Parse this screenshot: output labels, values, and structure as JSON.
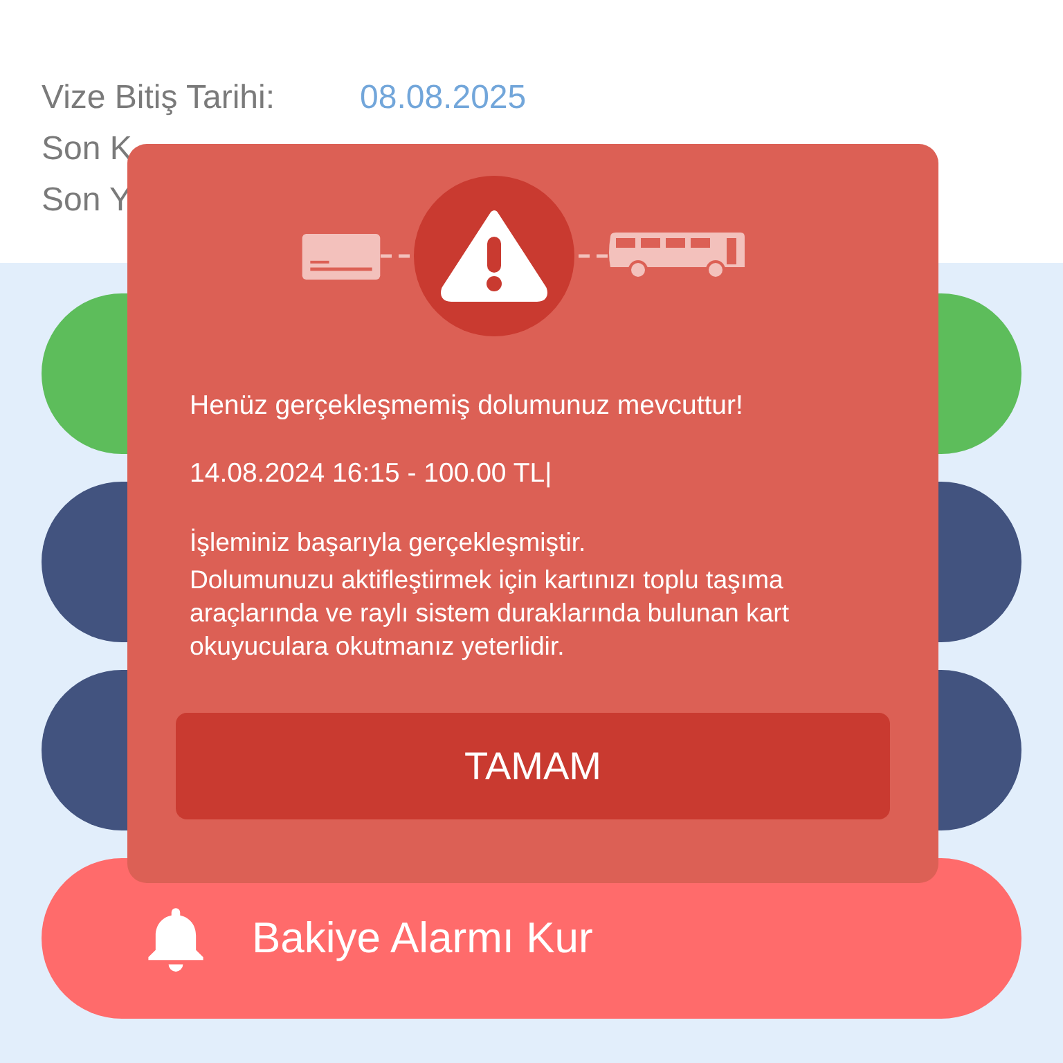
{
  "info_rows": [
    {
      "label": "Vize Bitiş Tarihi:",
      "value": "08.08.2025"
    },
    {
      "label": "Son K"
    },
    {
      "label": "Son Y"
    }
  ],
  "menu_buttons": [
    {
      "color": "#5dbd5b"
    },
    {
      "color": "#42537f"
    },
    {
      "color": "#42537f"
    },
    {
      "color": "#ff6b6b",
      "label": "Bakiye Alarmı Kur"
    }
  ],
  "dialog": {
    "message": "Henüz gerçekleşmemiş dolumunuz mevcuttur!",
    "detail": "14.08.2024 16:15 - 100.00 TL|",
    "body": [
      "İşleminiz başarıyla gerçekleşmiştir.",
      "Dolumunuzu aktifleştirmek için kartınızı toplu taşıma araçlarında ve raylı sistem duraklarında bulunan kart okuyuculara okutmanız yeterlidir."
    ],
    "button": "TAMAM"
  }
}
